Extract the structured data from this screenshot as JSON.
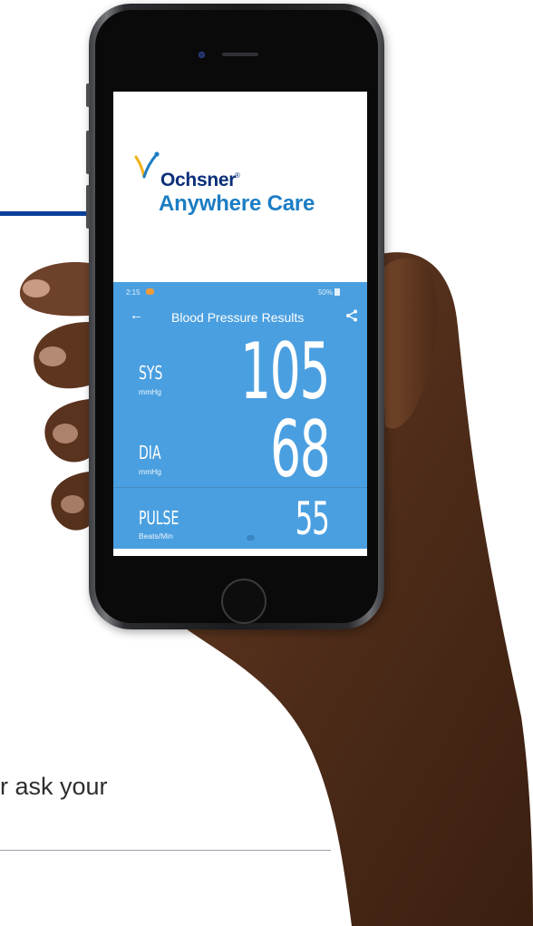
{
  "caption": "r ask your",
  "brand": {
    "name": "Ochsner",
    "trademark": "®",
    "subtitle": "Anywhere Care"
  },
  "status_bar": {
    "time": "2:15",
    "signal_text": "50%"
  },
  "app": {
    "title": "Blood Pressure Results",
    "back_icon": "arrow-left-icon",
    "share_icon": "share-icon"
  },
  "readings": {
    "sys": {
      "label": "SYS",
      "unit": "mmHg",
      "value": "105"
    },
    "dia": {
      "label": "DIA",
      "unit": "mmHg",
      "value": "68"
    },
    "pulse": {
      "label": "PULSE",
      "unit": "Beats/Min",
      "value": "55"
    }
  },
  "colors": {
    "app_background": "#4a9fe0",
    "brand_dark": "#0b2f7a",
    "brand_light": "#1c7dc4",
    "accent_rule": "#0b3f9a"
  }
}
